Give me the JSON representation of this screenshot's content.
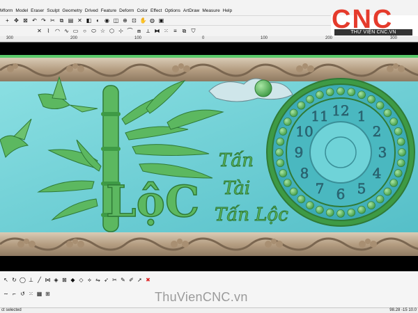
{
  "menu": [
    "Mform",
    "Model",
    "Eraser",
    "Sculpt",
    "Geometry",
    "Drived",
    "Feature",
    "Deform",
    "Color",
    "Effect",
    "Options",
    "ArtDraw",
    "Measure",
    "Help"
  ],
  "toolbar1_icons": [
    "select-icon",
    "move-icon",
    "transform-icon",
    "undo-icon",
    "redo-icon",
    "cut-icon",
    "copy-icon",
    "paste-icon",
    "delete-icon",
    "color-icon",
    "shade-icon",
    "shape-icon",
    "view-icon",
    "zoom-in-icon",
    "zoom-region-icon",
    "pan-icon",
    "render-icon",
    "camera-icon"
  ],
  "toolbar2_icons": [
    "close-icon",
    "polyline-icon",
    "arc-icon",
    "curve-icon",
    "rectangle-icon",
    "circle-icon",
    "ellipse-icon",
    "star-icon",
    "polygon-icon",
    "node-icon",
    "fillet-icon",
    "offset-icon",
    "trim-icon",
    "mirror-icon",
    "array-icon",
    "align-icon",
    "group-icon",
    "shield-icon"
  ],
  "ruler": {
    "ticks": [
      "300",
      "200",
      "100",
      "0",
      "100",
      "200",
      "300"
    ]
  },
  "logo": {
    "text": "CNC",
    "subtitle": "THƯ VIỆN CNC.VN",
    "color": "#e53b2c"
  },
  "relief": {
    "calligraphy_main": "LộC",
    "calligraphy_lines": [
      "Tấn",
      "Tài",
      "Tấn Lộc"
    ],
    "clock_numerals": [
      "12",
      "1",
      "2",
      "3",
      "4",
      "5",
      "6",
      "7",
      "8",
      "9",
      "10",
      "11"
    ],
    "colors": {
      "relief_green": "#5cb860",
      "relief_blue": "#5fc9cf",
      "border_tan": "#b9a58a",
      "background": "#000000"
    }
  },
  "bottom_icons_row1": [
    "pointer-icon",
    "rotate-icon",
    "circle-tool-icon",
    "perpendicular-icon",
    "line-icon",
    "weld-icon",
    "node-edit-icon",
    "transform-icon",
    "diamond-icon",
    "diamond-outline-icon",
    "diamond-alt-icon",
    "flip-icon",
    "vector-icon",
    "scissors-icon",
    "pen-icon",
    "pen-alt-icon",
    "arrow-icon",
    "delete-x-icon"
  ],
  "bottom_icons_row2": [
    "spline-icon",
    "corner-icon",
    "rotate-ccw-icon",
    "array-icon",
    "grid-icon",
    "node-grid-icon"
  ],
  "watermark": "ThuVienCNC.vn",
  "status": {
    "left": "ct selected",
    "right": "98.28 -15 10.0"
  }
}
